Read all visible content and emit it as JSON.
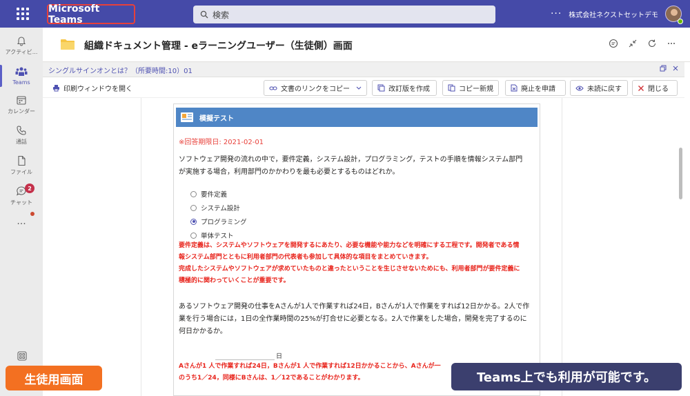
{
  "app": {
    "title": "Microsoft Teams"
  },
  "search": {
    "placeholder": "検索"
  },
  "top_right": {
    "more": "···",
    "org": "株式会社ネクストセットデモ"
  },
  "rail": {
    "items": [
      {
        "label": "アクティビ...",
        "icon": "bell-icon"
      },
      {
        "label": "Teams",
        "icon": "teams-icon"
      },
      {
        "label": "カレンダー",
        "icon": "calendar-icon"
      },
      {
        "label": "通話",
        "icon": "phone-icon"
      },
      {
        "label": "ファイル",
        "icon": "file-icon"
      },
      {
        "label": "チャット",
        "icon": "chat-icon"
      }
    ],
    "chat_badge": "2",
    "more": "···"
  },
  "header": {
    "title": "組織ドキュメント管理 - eラーニングユーザー（生徒側）画面"
  },
  "subtab": {
    "title": "シングルサインオンとは？（所要時間:10）01"
  },
  "toolbar": {
    "print": "印刷ウィンドウを開く",
    "copy_link": "文書のリンクをコピー",
    "revise": "改訂版を作成",
    "copy_new": "コピー新規",
    "discard": "廃止を申請",
    "unread": "未読に戻す",
    "close": "閉じる"
  },
  "test": {
    "title": "模擬テスト",
    "deadline": "※回答期限日: 2021-02-01",
    "q1_line1": "ソフトウェア開発の流れの中で，要件定義，システム設計，プログラミング，テストの手順を情報システム部門",
    "q1_line2": "が実施する場合，利用部門のかかわりを最も必要とするものはどれか。",
    "options": [
      "要件定義",
      "システム設計",
      "プログラミング",
      "単体テスト"
    ],
    "selected_index": 2,
    "exp1_line1": "要件定義は、システムやソフトウェアを開発するにあたり、必要な機能や能力などを明確にする工程です。開発者である情",
    "exp1_line2": "報システム部門とともに利用者部門の代表者も参加して具体的な項目をまとめていきます。",
    "exp1_line3": "完成したシステムやソフトウェアが求めていたものと違ったということを生じさせないためにも、利用者部門が要件定義に",
    "exp1_line4": "積極的に関わっていくことが重要です。",
    "q2_line1": "あるソフトウェア開発の仕事をAさんが1人で作業すれば24日，Bさんが1人で作業をすれば12日かかる。2人で作",
    "q2_line2": "業を行う場合には，1日の全作業時間の25%が打合せに必要となる。2人で作業をした場合，開発を完了するのに",
    "q2_line3": "何日かかるか。",
    "blank_unit": "日",
    "exp2_line1": "Aさんが1 人で作業すれば24日，Bさんが1 人で作業すれば12日かかることから、Aさんが一",
    "exp2_line2": "のうち1／24，同様にBさんは、1／12であることがわかります。"
  },
  "overlay": {
    "left": "生徒用画面",
    "right": "Teams上でも利用が可能です。"
  },
  "colors": {
    "topbar": "#454aa8",
    "accent": "#4f52b2",
    "test_header": "#4f86c6",
    "red": "#e8403a",
    "orange_tag": "#f37021",
    "navy_tag": "#3b3f6e"
  }
}
